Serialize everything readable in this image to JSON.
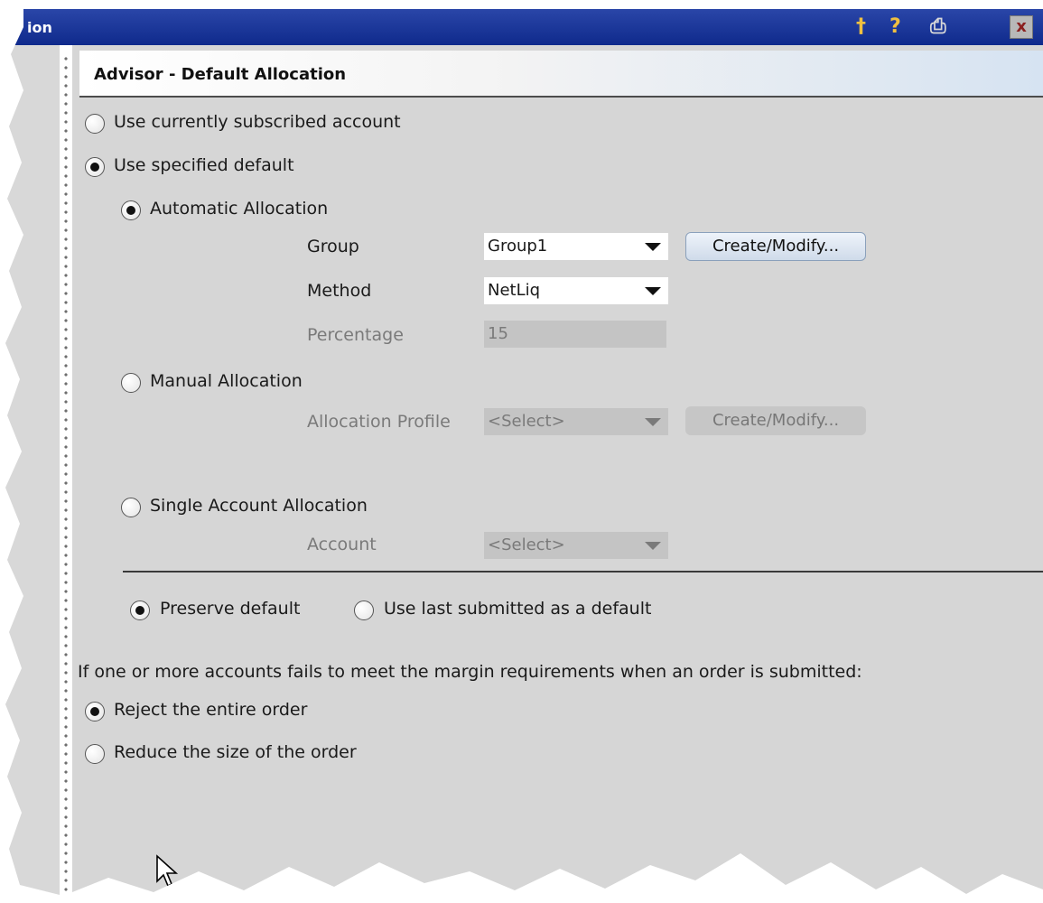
{
  "window": {
    "title_fragment": "ion"
  },
  "titlebar_icons": [
    "pin-icon",
    "help-icon",
    "print-icon",
    "close-icon"
  ],
  "panel_title": "Advisor - Default Allocation",
  "default_options": [
    {
      "label": "Use currently subscribed account",
      "selected": false
    },
    {
      "label": "Use specified default",
      "selected": true
    }
  ],
  "automatic": {
    "label": "Automatic Allocation",
    "selected": true,
    "group": {
      "label": "Group",
      "value": "Group1"
    },
    "method": {
      "label": "Method",
      "value": "NetLiq"
    },
    "percentage": {
      "label": "Percentage",
      "value": "15"
    },
    "create_button": "Create/Modify..."
  },
  "manual": {
    "label": "Manual Allocation",
    "selected": false,
    "profile": {
      "label": "Allocation Profile",
      "value": "<Select>"
    },
    "create_button": "Create/Modify..."
  },
  "single": {
    "label": "Single Account Allocation",
    "selected": false,
    "account": {
      "label": "Account",
      "value": "<Select>"
    }
  },
  "preserve_options": [
    {
      "label": "Preserve default",
      "selected": true
    },
    {
      "label": "Use last submitted as a default",
      "selected": false
    }
  ],
  "margin": {
    "question": "If one or more accounts fails to meet the margin requirements when an order is submitted:",
    "options": [
      {
        "label": "Reject the entire order",
        "selected": true
      },
      {
        "label": "Reduce the size of the order",
        "selected": false
      }
    ]
  },
  "colors": {
    "titlebar": "#1a36a0",
    "panel": "#d6d6d6",
    "button_enabled": "#dde6f1",
    "disabled_text": "#7a7a7a"
  }
}
